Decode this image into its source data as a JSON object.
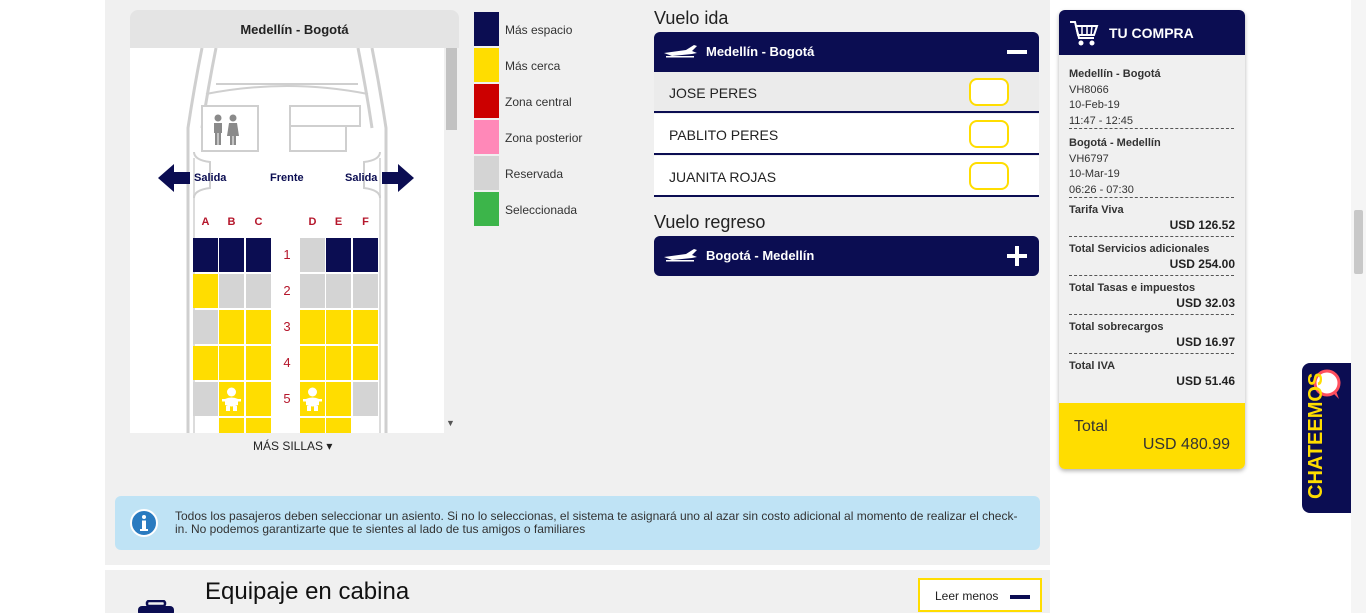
{
  "seatmap": {
    "title": "Medellín - Bogotá",
    "front_label": "Frente",
    "exit_left": "Salida",
    "exit_right": "Salida",
    "columns_left": [
      "A",
      "B",
      "C"
    ],
    "columns_right": [
      "D",
      "E",
      "F"
    ],
    "rows": [
      {
        "num": "1",
        "seats": [
          "navy",
          "navy",
          "navy",
          "gray",
          "navy",
          "navy"
        ]
      },
      {
        "num": "2",
        "seats": [
          "yellow",
          "gray",
          "gray",
          "gray",
          "gray",
          "gray"
        ]
      },
      {
        "num": "3",
        "seats": [
          "gray",
          "yellow",
          "yellow",
          "yellow",
          "yellow",
          "yellow"
        ]
      },
      {
        "num": "4",
        "seats": [
          "yellow",
          "yellow",
          "yellow",
          "yellow",
          "yellow",
          "yellow"
        ]
      },
      {
        "num": "5",
        "seats": [
          "gray",
          "yellow",
          "yellow",
          "yellow",
          "yellow",
          "gray"
        ],
        "baby_icons": [
          "B",
          "D"
        ]
      }
    ],
    "more_label": "MÁS SILLAS ▾"
  },
  "legend": [
    {
      "label": "Más espacio",
      "color": "#0b0d52"
    },
    {
      "label": "Más cerca",
      "color": "#ffdd00"
    },
    {
      "label": "Zona central",
      "color": "#cc0000"
    },
    {
      "label": "Zona posterior",
      "color": "#ff88b8"
    },
    {
      "label": "Reservada",
      "color": "#d4d4d4"
    },
    {
      "label": "Seleccionada",
      "color": "#3cb54a"
    }
  ],
  "outbound": {
    "section_title": "Vuelo ida",
    "route": "Medellín - Bogotá",
    "passengers": [
      "JOSE PERES",
      "PABLITO PERES",
      "JUANITA ROJAS"
    ]
  },
  "return": {
    "section_title": "Vuelo regreso",
    "route": "Bogotá - Medellín"
  },
  "summary": {
    "title": "TU COMPRA",
    "flight1": {
      "route": "Medellín - Bogotá",
      "code": "VH8066",
      "date": "10-Feb-19",
      "time": "11:47 - 12:45"
    },
    "flight2": {
      "route": "Bogotá - Medellín",
      "code": "VH6797",
      "date": "10-Mar-19",
      "time": "06:26 - 07:30"
    },
    "lines": [
      {
        "label": "Tarifa Viva",
        "value": "USD 126.52"
      },
      {
        "label": "Total Servicios adicionales",
        "value": "USD 254.00"
      },
      {
        "label": "Total Tasas e impuestos",
        "value": "USD 32.03"
      },
      {
        "label": "Total sobrecargos",
        "value": "USD 16.97"
      },
      {
        "label": "Total IVA",
        "value": "USD 51.46"
      }
    ],
    "total_label": "Total",
    "total_value": "USD 480.99"
  },
  "info": {
    "text": "Todos los pasajeros deben seleccionar un asiento. Si no lo seleccionas, el sistema te asignará uno al azar sin costo adicional al momento de realizar el check-in. No podemos garantizarte que te sientes al lado de tus amigos o familiares"
  },
  "baggage": {
    "title": "Equipaje en cabina",
    "toggle_label": "Leer menos"
  },
  "chat": {
    "label": "CHATEEMOS"
  }
}
